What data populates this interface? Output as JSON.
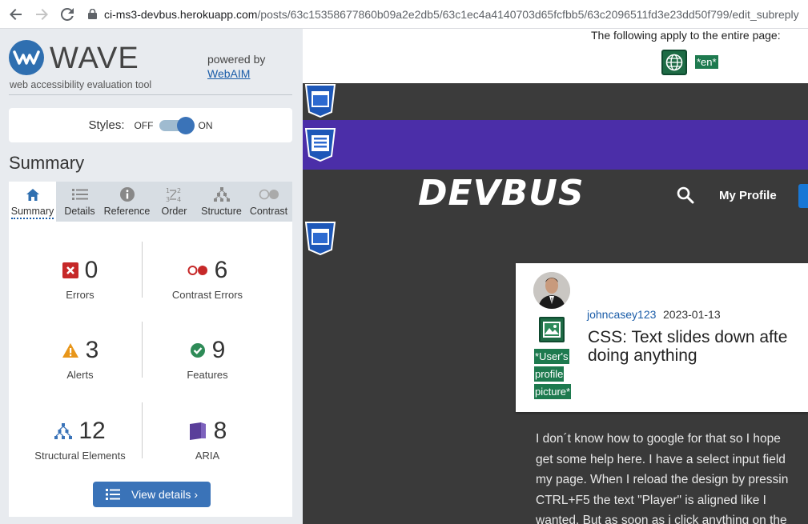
{
  "browser": {
    "url_host": "ci-ms3-devbus.herokuapp.com",
    "url_path": "/posts/63c15358677860b09a2e2db5/63c1ec4a4140703d65fcfbb5/63c2096511fd3e23dd50f799/edit_subreply"
  },
  "wave": {
    "name": "WAVE",
    "tagline": "web accessibility evaluation tool",
    "powered_by": "powered by",
    "webaim": "WebAIM",
    "styles_label": "Styles:",
    "styles_off": "OFF",
    "styles_on": "ON",
    "summary_title": "Summary",
    "tabs": [
      {
        "label": "Summary",
        "icon": "home-icon"
      },
      {
        "label": "Details",
        "icon": "list-icon"
      },
      {
        "label": "Reference",
        "icon": "info-icon"
      },
      {
        "label": "Order",
        "icon": "order-icon"
      },
      {
        "label": "Structure",
        "icon": "structure-icon"
      },
      {
        "label": "Contrast",
        "icon": "contrast-icon"
      }
    ],
    "stats": {
      "errors": {
        "value": "0",
        "label": "Errors"
      },
      "contrast_errors": {
        "value": "6",
        "label": "Contrast Errors"
      },
      "alerts": {
        "value": "3",
        "label": "Alerts"
      },
      "features": {
        "value": "9",
        "label": "Features"
      },
      "structural": {
        "value": "12",
        "label": "Structural Elements"
      },
      "aria": {
        "value": "8",
        "label": "ARIA"
      }
    },
    "view_details": "View details ›",
    "colors": {
      "accent": "#3a73b8",
      "error": "#c62828",
      "alert": "#e8961a",
      "feature": "#2e8b57",
      "aria": "#5a3e9a"
    }
  },
  "page": {
    "entire_page": "The following apply to the entire page:",
    "lang_tag": "*en*",
    "logo": "DEVBUS",
    "my_profile": "My Profile",
    "author": "johncasey123",
    "date": "2023-01-13",
    "alt_lines": [
      "*User's",
      "profile",
      "picture*"
    ],
    "title_line1": "CSS: Text slides down afte",
    "title_line2": "doing anything",
    "body_lines": [
      "I don´t know how to google for that so I hope",
      "get some help here. I have a select input field",
      "my page. When I reload the design by pressin",
      "CTRL+F5 the text \"Player\" is aligned like I",
      "wanted. But as soon as i click anything on the"
    ]
  }
}
